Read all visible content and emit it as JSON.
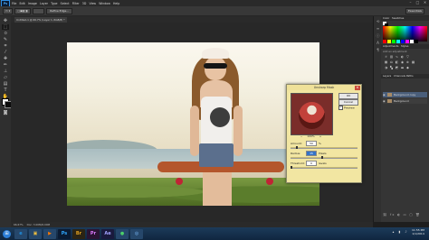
{
  "menubar": {
    "logo": "Ps",
    "items": [
      "File",
      "Edit",
      "Image",
      "Layer",
      "Type",
      "Select",
      "Filter",
      "3D",
      "View",
      "Window",
      "Help"
    ],
    "window_controls": [
      "–",
      "□",
      "✕"
    ]
  },
  "options": {
    "tool_label": "",
    "mode": "Refine Edge...",
    "workspace": "Essentials"
  },
  "document": {
    "tab_title": "Untitled-1 @ 66.7% (Layer 1, RGB/8) *"
  },
  "dialog": {
    "title": "Unsharp Mask",
    "ok_label": "OK",
    "cancel_label": "Cancel",
    "preview_label": "Preview",
    "preview_checked": "✓",
    "zoom_out": "−",
    "zoom_level": "100%",
    "zoom_in": "+",
    "amount_label": "Amount:",
    "amount_value": "50",
    "amount_unit": "%",
    "radius_label": "Radius:",
    "radius_value": "15",
    "radius_unit": "Pixels",
    "threshold_label": "Threshold:",
    "threshold_value": "0",
    "threshold_unit": "levels"
  },
  "panels": {
    "color_tab": "Color",
    "swatches_tab": "Swatches",
    "adjustments_tab": "Adjustments",
    "styles_tab": "Styles",
    "add_adjustment_label": "Add an adjustment",
    "layers_tab": "Layers",
    "channels_tab": "Channels",
    "paths_tab": "Paths",
    "layers": [
      {
        "name": "Background copy"
      },
      {
        "name": "Background"
      }
    ],
    "swatches": [
      "#ff0000",
      "#ffff00",
      "#00ff00",
      "#00ffff",
      "#0000ff",
      "#ff00ff",
      "#ffffff",
      "#000000"
    ]
  },
  "status": {
    "zoom": "66.67%",
    "doc_info": "Doc: 3.00M/6.00M"
  },
  "taskbar": {
    "start": "⊞",
    "apps": [
      {
        "label": "e",
        "color": "#1e8fe0",
        "bg": "#26476b"
      },
      {
        "label": "▣",
        "color": "#f0c040",
        "bg": "#26476b"
      },
      {
        "label": "▶",
        "color": "#ff7a00",
        "bg": "#26476b"
      },
      {
        "label": "Ps",
        "color": "#31a8ff",
        "bg": "#0a1b33"
      },
      {
        "label": "Br",
        "color": "#e0a020",
        "bg": "#2b2414"
      },
      {
        "label": "Pr",
        "color": "#e07cff",
        "bg": "#2a1433"
      },
      {
        "label": "Ae",
        "color": "#a3a3ff",
        "bg": "#1a1a3d"
      },
      {
        "label": "●",
        "color": "#4cd06a",
        "bg": "#26476b"
      },
      {
        "label": "◎",
        "color": "#7fbfff",
        "bg": "#26476b"
      }
    ],
    "clock_time": "11:55 PM",
    "clock_date": "1/1/2014"
  }
}
